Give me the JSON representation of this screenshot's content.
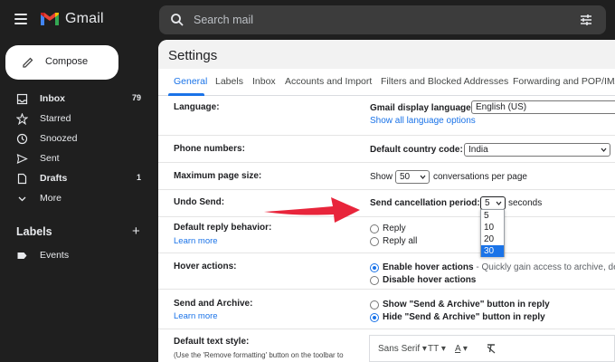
{
  "app": {
    "name": "Gmail"
  },
  "search": {
    "placeholder": "Search mail"
  },
  "sidebar": {
    "compose_label": "Compose",
    "items": [
      {
        "label": "Inbox",
        "count": "79",
        "icon": "inbox-icon",
        "bold": true
      },
      {
        "label": "Starred",
        "count": "",
        "icon": "star-icon",
        "bold": false
      },
      {
        "label": "Snoozed",
        "count": "",
        "icon": "clock-icon",
        "bold": false
      },
      {
        "label": "Sent",
        "count": "",
        "icon": "send-icon",
        "bold": false
      },
      {
        "label": "Drafts",
        "count": "1",
        "icon": "draft-icon",
        "bold": true
      },
      {
        "label": "More",
        "count": "",
        "icon": "chevron-down-icon",
        "bold": false
      }
    ],
    "labels_heading": "Labels",
    "labels": [
      {
        "label": "Events",
        "icon": "label-icon"
      }
    ]
  },
  "settings": {
    "title": "Settings",
    "tabs": [
      "General",
      "Labels",
      "Inbox",
      "Accounts and Import",
      "Filters and Blocked Addresses",
      "Forwarding and POP/IMA"
    ],
    "active_tab": "General",
    "rows": {
      "language": {
        "label": "Language:",
        "field_label": "Gmail display language:",
        "value": "English (US)",
        "link": "Show all language options"
      },
      "phone": {
        "label": "Phone numbers:",
        "field_label": "Default country code:",
        "value": "India"
      },
      "page_size": {
        "label": "Maximum page size:",
        "prefix": "Show",
        "value": "50",
        "suffix": "conversations per page"
      },
      "undo_send": {
        "label": "Undo Send:",
        "field_label": "Send cancellation period:",
        "value": "5",
        "suffix": "seconds",
        "options": [
          "5",
          "10",
          "20",
          "30"
        ],
        "highlighted_option": "30"
      },
      "reply": {
        "label": "Default reply behavior:",
        "link": "Learn more",
        "options": [
          "Reply",
          "Reply all"
        ]
      },
      "hover": {
        "label": "Hover actions:",
        "options": [
          "Enable hover actions",
          "Disable hover actions"
        ],
        "option_detail": " - Quickly gain access to archive, del"
      },
      "send_archive": {
        "label": "Send and Archive:",
        "link": "Learn more",
        "options": [
          "Show \"Send & Archive\" button in reply",
          "Hide \"Send & Archive\" button in reply"
        ]
      },
      "text_style": {
        "label": "Default text style:",
        "note": "(Use the 'Remove formatting' button on the toolbar to",
        "font": "Sans Serif"
      }
    }
  },
  "colors": {
    "accent": "#1a73e8",
    "sidebar_bg": "#1f1f1f",
    "arrow": "#e8253b"
  }
}
